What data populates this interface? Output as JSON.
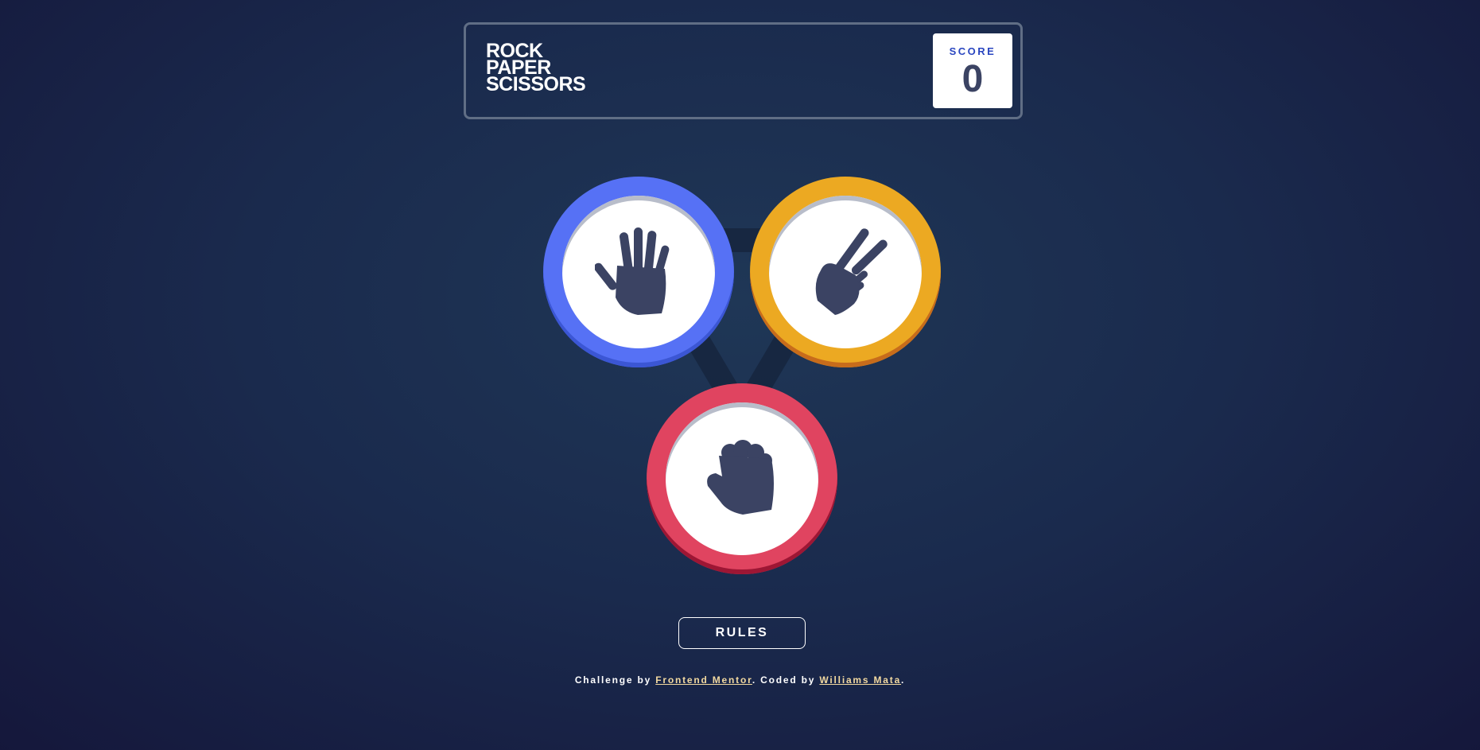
{
  "header": {
    "title_lines": [
      "Rock",
      "Paper",
      "Scissors"
    ],
    "score_label": "SCORE",
    "score_value": "0"
  },
  "choices": [
    {
      "name": "paper",
      "icon": "paper-hand-icon",
      "color": "#5671f5"
    },
    {
      "name": "scissors",
      "icon": "scissors-hand-icon",
      "color": "#eca922"
    },
    {
      "name": "rock",
      "icon": "rock-fist-icon",
      "color": "#e04460"
    }
  ],
  "rules_label": "RULES",
  "attribution": {
    "prefix": "Challenge by ",
    "link1": "Frontend Mentor",
    "middle": ". Coded by ",
    "link2": "Williams Mata",
    "suffix": "."
  },
  "colors": {
    "header_border": "#606e85",
    "score_label": "#2a46c0",
    "score_value": "#3b4363",
    "link": "#f2d9a0"
  }
}
